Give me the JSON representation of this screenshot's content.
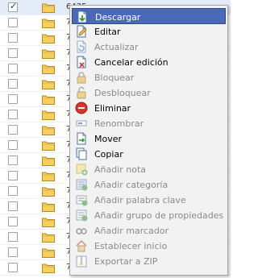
{
  "file_list": {
    "rows": [
      {
        "checked": true,
        "selected": true,
        "name": "6435"
      },
      {
        "checked": false,
        "selected": false,
        "name": "7"
      },
      {
        "checked": false,
        "selected": false,
        "name": "7"
      },
      {
        "checked": false,
        "selected": false,
        "name": "7"
      },
      {
        "checked": false,
        "selected": false,
        "name": "7"
      },
      {
        "checked": false,
        "selected": false,
        "name": "7"
      },
      {
        "checked": false,
        "selected": false,
        "name": "7"
      },
      {
        "checked": false,
        "selected": false,
        "name": "7"
      },
      {
        "checked": false,
        "selected": false,
        "name": "7"
      },
      {
        "checked": false,
        "selected": false,
        "name": "7"
      },
      {
        "checked": false,
        "selected": false,
        "name": "7"
      },
      {
        "checked": false,
        "selected": false,
        "name": "7"
      },
      {
        "checked": false,
        "selected": false,
        "name": "7"
      },
      {
        "checked": false,
        "selected": false,
        "name": "7"
      },
      {
        "checked": false,
        "selected": false,
        "name": "7"
      },
      {
        "checked": false,
        "selected": false,
        "name": "7"
      },
      {
        "checked": false,
        "selected": false,
        "name": "7"
      },
      {
        "checked": false,
        "selected": false,
        "name": "7"
      }
    ]
  },
  "context_menu": {
    "items": [
      {
        "label": "Descargar",
        "icon": "download-icon",
        "enabled": true,
        "highlighted": true
      },
      {
        "label": "Editar",
        "icon": "edit-icon",
        "enabled": true,
        "highlighted": false
      },
      {
        "label": "Actualizar",
        "icon": "update-icon",
        "enabled": false,
        "highlighted": false
      },
      {
        "label": "Cancelar edición",
        "icon": "cancel-edit-icon",
        "enabled": true,
        "highlighted": false
      },
      {
        "label": "Bloquear",
        "icon": "lock-icon",
        "enabled": false,
        "highlighted": false
      },
      {
        "label": "Desbloquear",
        "icon": "unlock-icon",
        "enabled": false,
        "highlighted": false
      },
      {
        "label": "Eliminar",
        "icon": "delete-icon",
        "enabled": true,
        "highlighted": false
      },
      {
        "label": "Renombrar",
        "icon": "rename-icon",
        "enabled": false,
        "highlighted": false
      },
      {
        "label": "Mover",
        "icon": "move-icon",
        "enabled": true,
        "highlighted": false
      },
      {
        "label": "Copiar",
        "icon": "copy-icon",
        "enabled": true,
        "highlighted": false
      },
      {
        "label": "Añadir nota",
        "icon": "add-note-icon",
        "enabled": false,
        "highlighted": false
      },
      {
        "label": "Añadir categoría",
        "icon": "add-category-icon",
        "enabled": false,
        "highlighted": false
      },
      {
        "label": "Añadir palabra clave",
        "icon": "add-keyword-icon",
        "enabled": false,
        "highlighted": false
      },
      {
        "label": "Añadir grupo de propiedades",
        "icon": "add-property-group-icon",
        "enabled": false,
        "highlighted": false
      },
      {
        "label": "Añadir marcador",
        "icon": "add-bookmark-icon",
        "enabled": false,
        "highlighted": false
      },
      {
        "label": "Establecer inicio",
        "icon": "set-home-icon",
        "enabled": false,
        "highlighted": false
      },
      {
        "label": "Exportar a ZIP",
        "icon": "export-zip-icon",
        "enabled": false,
        "highlighted": false
      }
    ]
  },
  "colors": {
    "menu_highlight": "#4a6ab8",
    "menu_background": "#f2f2f2",
    "disabled_text": "#8a8a8a",
    "row_selected": "#e3ebf7"
  }
}
